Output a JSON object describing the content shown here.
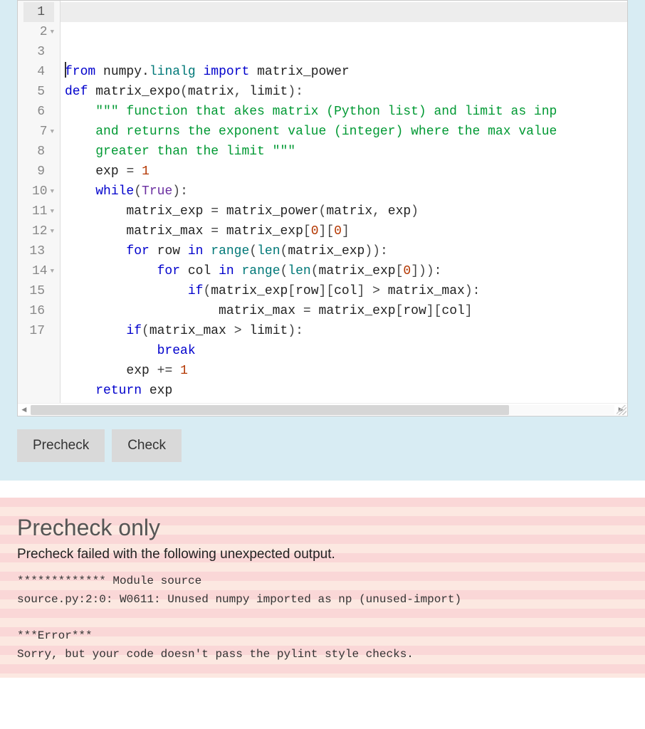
{
  "editor": {
    "active_line": 1,
    "lines": [
      {
        "n": 1,
        "fold": false,
        "tokens": [
          [
            "kw",
            "from"
          ],
          [
            "sp",
            " "
          ],
          [
            "id",
            "numpy"
          ],
          [
            "dot",
            "."
          ],
          [
            "mod",
            "linalg"
          ],
          [
            "sp",
            " "
          ],
          [
            "kw",
            "import"
          ],
          [
            "sp",
            " "
          ],
          [
            "id",
            "matrix_power"
          ]
        ]
      },
      {
        "n": 2,
        "fold": true,
        "tokens": [
          [
            "kw",
            "def"
          ],
          [
            "sp",
            " "
          ],
          [
            "id",
            "matrix_expo"
          ],
          [
            "op",
            "("
          ],
          [
            "id",
            "matrix"
          ],
          [
            "op",
            ","
          ],
          [
            "sp",
            " "
          ],
          [
            "id",
            "limit"
          ],
          [
            "op",
            ")"
          ],
          [
            "op",
            ":"
          ]
        ]
      },
      {
        "n": 3,
        "fold": false,
        "indent": 1,
        "tokens": [
          [
            "str",
            "\"\"\" function that akes matrix (Python list) and limit as inp"
          ]
        ]
      },
      {
        "n": 4,
        "fold": false,
        "indent": 1,
        "tokens": [
          [
            "str",
            "and returns the exponent value (integer) where the max value"
          ]
        ]
      },
      {
        "n": 5,
        "fold": false,
        "indent": 1,
        "tokens": [
          [
            "str",
            "greater than the limit \"\"\""
          ]
        ]
      },
      {
        "n": 6,
        "fold": false,
        "indent": 1,
        "tokens": [
          [
            "id",
            "exp"
          ],
          [
            "sp",
            " "
          ],
          [
            "op",
            "="
          ],
          [
            "sp",
            " "
          ],
          [
            "num",
            "1"
          ]
        ]
      },
      {
        "n": 7,
        "fold": true,
        "indent": 1,
        "tokens": [
          [
            "kw",
            "while"
          ],
          [
            "op",
            "("
          ],
          [
            "const",
            "True"
          ],
          [
            "op",
            ")"
          ],
          [
            "op",
            ":"
          ]
        ]
      },
      {
        "n": 8,
        "fold": false,
        "indent": 2,
        "tokens": [
          [
            "id",
            "matrix_exp"
          ],
          [
            "sp",
            " "
          ],
          [
            "op",
            "="
          ],
          [
            "sp",
            " "
          ],
          [
            "id",
            "matrix_power"
          ],
          [
            "op",
            "("
          ],
          [
            "id",
            "matrix"
          ],
          [
            "op",
            ","
          ],
          [
            "sp",
            " "
          ],
          [
            "id",
            "exp"
          ],
          [
            "op",
            ")"
          ]
        ]
      },
      {
        "n": 9,
        "fold": false,
        "indent": 2,
        "tokens": [
          [
            "id",
            "matrix_max"
          ],
          [
            "sp",
            " "
          ],
          [
            "op",
            "="
          ],
          [
            "sp",
            " "
          ],
          [
            "id",
            "matrix_exp"
          ],
          [
            "op",
            "["
          ],
          [
            "num",
            "0"
          ],
          [
            "op",
            "]"
          ],
          [
            "op",
            "["
          ],
          [
            "num",
            "0"
          ],
          [
            "op",
            "]"
          ]
        ]
      },
      {
        "n": 10,
        "fold": true,
        "indent": 2,
        "tokens": [
          [
            "kw",
            "for"
          ],
          [
            "sp",
            " "
          ],
          [
            "id",
            "row"
          ],
          [
            "sp",
            " "
          ],
          [
            "kw",
            "in"
          ],
          [
            "sp",
            " "
          ],
          [
            "builtin",
            "range"
          ],
          [
            "op",
            "("
          ],
          [
            "builtin",
            "len"
          ],
          [
            "op",
            "("
          ],
          [
            "id",
            "matrix_exp"
          ],
          [
            "op",
            ")"
          ],
          [
            "op",
            ")"
          ],
          [
            "op",
            ":"
          ]
        ]
      },
      {
        "n": 11,
        "fold": true,
        "indent": 3,
        "tokens": [
          [
            "kw",
            "for"
          ],
          [
            "sp",
            " "
          ],
          [
            "id",
            "col"
          ],
          [
            "sp",
            " "
          ],
          [
            "kw",
            "in"
          ],
          [
            "sp",
            " "
          ],
          [
            "builtin",
            "range"
          ],
          [
            "op",
            "("
          ],
          [
            "builtin",
            "len"
          ],
          [
            "op",
            "("
          ],
          [
            "id",
            "matrix_exp"
          ],
          [
            "op",
            "["
          ],
          [
            "num",
            "0"
          ],
          [
            "op",
            "]"
          ],
          [
            "op",
            ")"
          ],
          [
            "op",
            ")"
          ],
          [
            "op",
            ":"
          ]
        ]
      },
      {
        "n": 12,
        "fold": true,
        "indent": 4,
        "tokens": [
          [
            "kw",
            "if"
          ],
          [
            "op",
            "("
          ],
          [
            "id",
            "matrix_exp"
          ],
          [
            "op",
            "["
          ],
          [
            "id",
            "row"
          ],
          [
            "op",
            "]"
          ],
          [
            "op",
            "["
          ],
          [
            "id",
            "col"
          ],
          [
            "op",
            "]"
          ],
          [
            "sp",
            " "
          ],
          [
            "op",
            ">"
          ],
          [
            "sp",
            " "
          ],
          [
            "id",
            "matrix_max"
          ],
          [
            "op",
            ")"
          ],
          [
            "op",
            ":"
          ]
        ]
      },
      {
        "n": 13,
        "fold": false,
        "indent": 5,
        "tokens": [
          [
            "id",
            "matrix_max"
          ],
          [
            "sp",
            " "
          ],
          [
            "op",
            "="
          ],
          [
            "sp",
            " "
          ],
          [
            "id",
            "matrix_exp"
          ],
          [
            "op",
            "["
          ],
          [
            "id",
            "row"
          ],
          [
            "op",
            "]"
          ],
          [
            "op",
            "["
          ],
          [
            "id",
            "col"
          ],
          [
            "op",
            "]"
          ]
        ]
      },
      {
        "n": 14,
        "fold": true,
        "indent": 2,
        "tokens": [
          [
            "kw",
            "if"
          ],
          [
            "op",
            "("
          ],
          [
            "id",
            "matrix_max"
          ],
          [
            "sp",
            " "
          ],
          [
            "op",
            ">"
          ],
          [
            "sp",
            " "
          ],
          [
            "id",
            "limit"
          ],
          [
            "op",
            ")"
          ],
          [
            "op",
            ":"
          ]
        ]
      },
      {
        "n": 15,
        "fold": false,
        "indent": 3,
        "tokens": [
          [
            "kw",
            "break"
          ]
        ]
      },
      {
        "n": 16,
        "fold": false,
        "indent": 2,
        "tokens": [
          [
            "id",
            "exp"
          ],
          [
            "sp",
            " "
          ],
          [
            "op",
            "+="
          ],
          [
            "sp",
            " "
          ],
          [
            "num",
            "1"
          ]
        ]
      },
      {
        "n": 17,
        "fold": false,
        "indent": 1,
        "tokens": [
          [
            "kw",
            "return"
          ],
          [
            "sp",
            " "
          ],
          [
            "id",
            "exp"
          ]
        ]
      }
    ]
  },
  "buttons": {
    "precheck": "Precheck",
    "check": "Check"
  },
  "output": {
    "title": "Precheck only",
    "message": "Precheck failed with the following unexpected output.",
    "body1": "************* Module source\nsource.py:2:0: W0611: Unused numpy imported as np (unused-import)",
    "body2": "***Error***\nSorry, but your code doesn't pass the pylint style checks."
  }
}
